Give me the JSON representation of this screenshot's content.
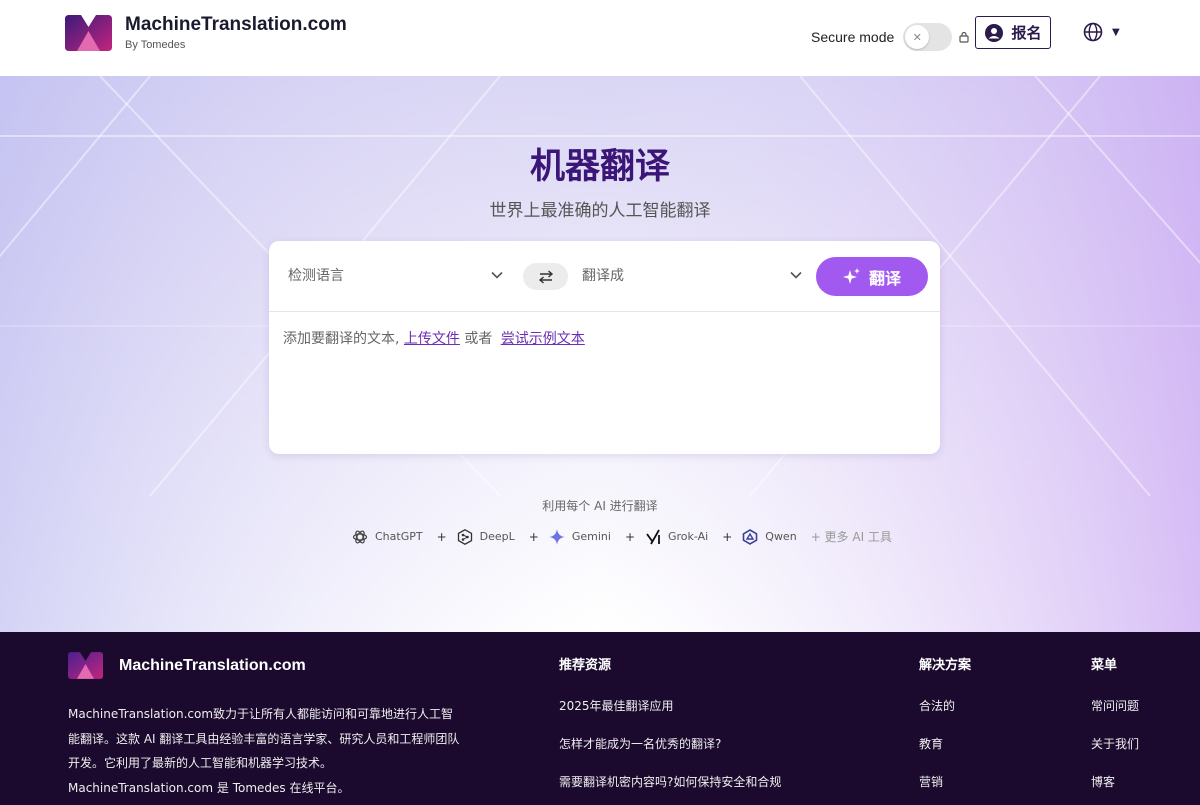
{
  "header": {
    "brand_name": "MachineTranslation.com",
    "brand_sub": "By Tomedes",
    "secure_mode_label": "Secure mode",
    "secure_mode_on": false,
    "signup_label": "报名"
  },
  "hero": {
    "title": "机器翻译",
    "subtitle": "世界上最准确的人工智能翻译"
  },
  "translator": {
    "source_placeholder": "检测语言",
    "target_placeholder": "翻译成",
    "translate_label": "翻译",
    "input_hint_prefix": "添加要翻译的文本,",
    "upload_link": "上传文件",
    "or_text": "或者",
    "sample_link": "尝试示例文本"
  },
  "ai": {
    "caption": "利用每个 AI 进行翻译",
    "engines": [
      {
        "name": "ChatGPT",
        "icon": "chatgpt-icon"
      },
      {
        "name": "DeepL",
        "icon": "deepl-icon"
      },
      {
        "name": "Gemini",
        "icon": "gemini-icon"
      },
      {
        "name": "Grok-Ai",
        "icon": "grok-icon"
      },
      {
        "name": "Qwen",
        "icon": "qwen-icon"
      }
    ],
    "more_label": "+ 更多 AI 工具"
  },
  "footer": {
    "brand_name": "MachineTranslation.com",
    "description": "MachineTranslation.com致力于让所有人都能访问和可靠地进行人工智能翻译。这款 AI 翻译工具由经验丰富的语言学家、研究人员和工程师团队开发。它利用了最新的人工智能和机器学习技术。MachineTranslation.com 是 Tomedes 在线平台。",
    "columns": [
      {
        "title": "推荐资源",
        "links": [
          "2025年最佳翻译应用",
          "怎样才能成为一名优秀的翻译?",
          "需要翻译机密内容吗?如何保持安全和合规"
        ]
      },
      {
        "title": "解决方案",
        "links": [
          "合法的",
          "教育",
          "营销"
        ]
      },
      {
        "title": "菜单",
        "links": [
          "常问问题",
          "关于我们",
          "博客"
        ]
      }
    ]
  },
  "colors": {
    "brand_purple": "#3b1678",
    "button_purple": "#a259f0",
    "footer_bg": "#1b0a2e",
    "link_purple": "#6b2fb3"
  }
}
